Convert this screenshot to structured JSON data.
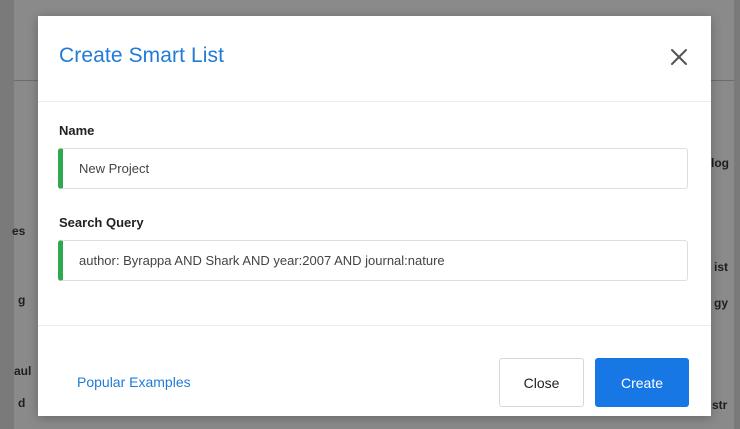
{
  "background": {
    "left_fragments": [
      "es",
      "g",
      "aul",
      "d"
    ],
    "right_fragments": [
      "log",
      "ist",
      "gy",
      "str"
    ]
  },
  "modal": {
    "title": "Create Smart List",
    "close_icon": "close-icon",
    "name_label": "Name",
    "name_value": "New Project",
    "query_label": "Search Query",
    "query_value": "author: Byrappa AND Shark AND year:2007 AND journal:nature",
    "popular_examples_link": "Popular Examples",
    "close_button": "Close",
    "create_button": "Create"
  },
  "colors": {
    "accent": "#1f7bd8",
    "primary_button": "#1677e5",
    "field_accent": "#2fa84f"
  }
}
